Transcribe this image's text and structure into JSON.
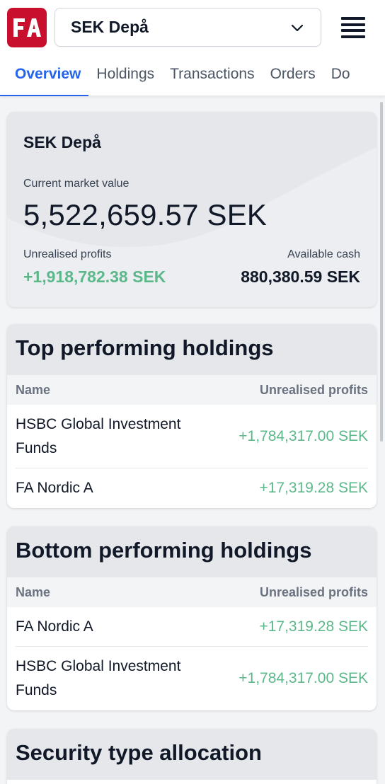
{
  "header": {
    "logo_text": "FA",
    "portfolio_selector": "SEK Depå"
  },
  "tabs": [
    {
      "label": "Overview"
    },
    {
      "label": "Holdings"
    },
    {
      "label": "Transactions"
    },
    {
      "label": "Orders"
    },
    {
      "label": "Do"
    }
  ],
  "summary": {
    "title": "SEK Depå",
    "market_value_label": "Current market value",
    "market_value": "5,522,659.57 SEK",
    "unrealised_label": "Unrealised profits",
    "unrealised_value": "+1,918,782.38 SEK",
    "cash_label": "Available cash",
    "cash_value": "880,380.59 SEK"
  },
  "top_holdings": {
    "title": "Top performing holdings",
    "col_name": "Name",
    "col_profit": "Unrealised profits",
    "rows": [
      {
        "name": "HSBC Global Investment Funds",
        "profit": "+1,784,317.00 SEK"
      },
      {
        "name": "FA Nordic A",
        "profit": "+17,319.28 SEK"
      }
    ]
  },
  "bottom_holdings": {
    "title": "Bottom performing holdings",
    "col_name": "Name",
    "col_profit": "Unrealised profits",
    "rows": [
      {
        "name": "FA Nordic A",
        "profit": "+17,319.28 SEK"
      },
      {
        "name": "HSBC Global Investment Funds",
        "profit": "+1,784,317.00 SEK"
      }
    ]
  },
  "allocation": {
    "title": "Security type allocation"
  },
  "colors": {
    "accent": "#2563eb",
    "positive": "#5cb88a",
    "brand": "#c8102e"
  }
}
